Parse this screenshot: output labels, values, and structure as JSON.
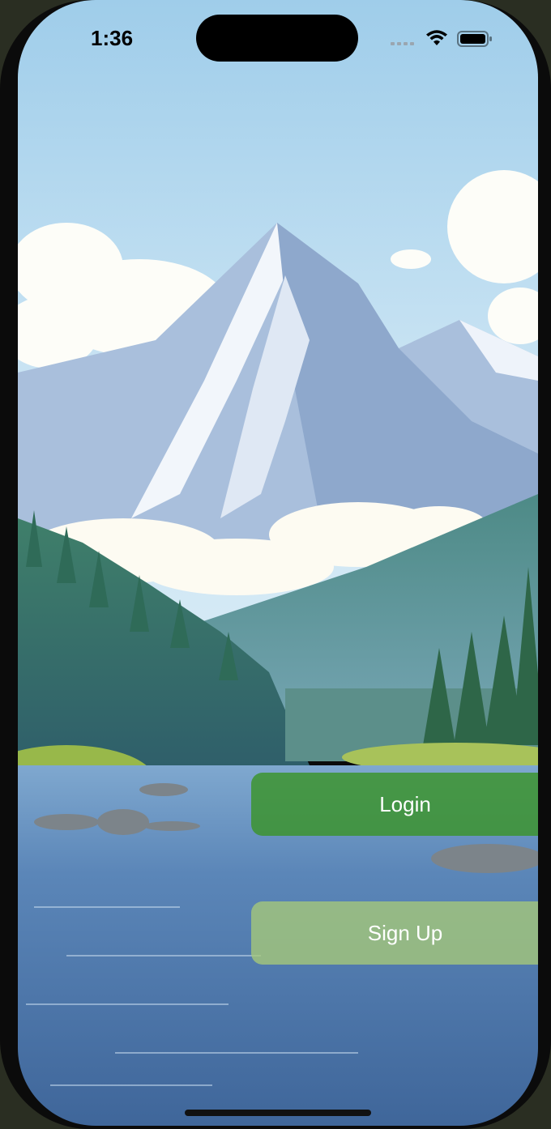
{
  "status_bar": {
    "time": "1:36",
    "signal_icon": "cellular-dots-icon",
    "wifi_icon": "wifi-icon",
    "battery_icon": "battery-icon"
  },
  "background": {
    "scene": "mountain-lake-background"
  },
  "actions": {
    "login_label": "Login",
    "signup_label": "Sign Up"
  },
  "colors": {
    "login_button": "#3A942A",
    "signup_button": "#A6C978",
    "sky": "#BFE0F4",
    "water": "#4C78A8"
  }
}
